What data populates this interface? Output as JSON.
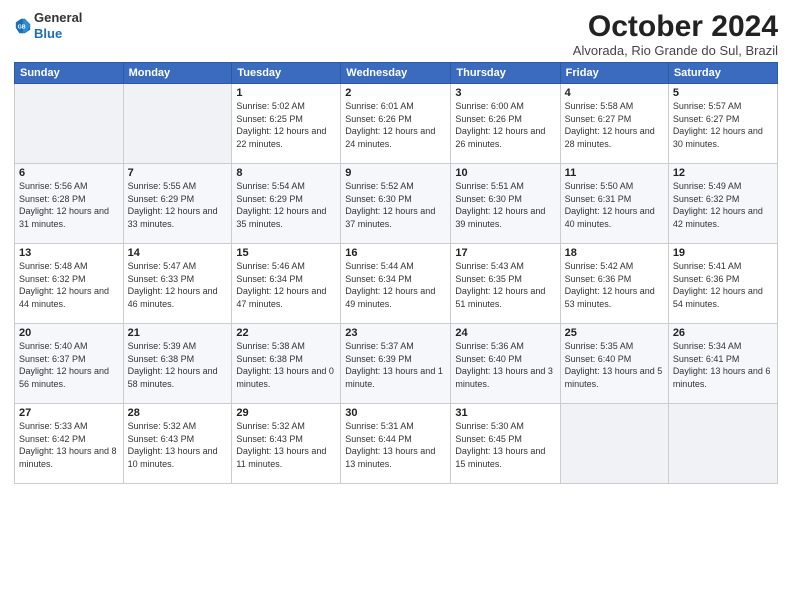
{
  "header": {
    "logo_line1": "General",
    "logo_line2": "Blue",
    "month": "October 2024",
    "location": "Alvorada, Rio Grande do Sul, Brazil"
  },
  "days_of_week": [
    "Sunday",
    "Monday",
    "Tuesday",
    "Wednesday",
    "Thursday",
    "Friday",
    "Saturday"
  ],
  "weeks": [
    [
      {
        "day": "",
        "empty": true
      },
      {
        "day": "",
        "empty": true
      },
      {
        "day": "1",
        "sunrise": "5:02 AM",
        "sunset": "6:25 PM",
        "daylight": "12 hours and 22 minutes."
      },
      {
        "day": "2",
        "sunrise": "6:01 AM",
        "sunset": "6:26 PM",
        "daylight": "12 hours and 24 minutes."
      },
      {
        "day": "3",
        "sunrise": "6:00 AM",
        "sunset": "6:26 PM",
        "daylight": "12 hours and 26 minutes."
      },
      {
        "day": "4",
        "sunrise": "5:58 AM",
        "sunset": "6:27 PM",
        "daylight": "12 hours and 28 minutes."
      },
      {
        "day": "5",
        "sunrise": "5:57 AM",
        "sunset": "6:27 PM",
        "daylight": "12 hours and 30 minutes."
      }
    ],
    [
      {
        "day": "6",
        "sunrise": "5:56 AM",
        "sunset": "6:28 PM",
        "daylight": "12 hours and 31 minutes."
      },
      {
        "day": "7",
        "sunrise": "5:55 AM",
        "sunset": "6:29 PM",
        "daylight": "12 hours and 33 minutes."
      },
      {
        "day": "8",
        "sunrise": "5:54 AM",
        "sunset": "6:29 PM",
        "daylight": "12 hours and 35 minutes."
      },
      {
        "day": "9",
        "sunrise": "5:52 AM",
        "sunset": "6:30 PM",
        "daylight": "12 hours and 37 minutes."
      },
      {
        "day": "10",
        "sunrise": "5:51 AM",
        "sunset": "6:30 PM",
        "daylight": "12 hours and 39 minutes."
      },
      {
        "day": "11",
        "sunrise": "5:50 AM",
        "sunset": "6:31 PM",
        "daylight": "12 hours and 40 minutes."
      },
      {
        "day": "12",
        "sunrise": "5:49 AM",
        "sunset": "6:32 PM",
        "daylight": "12 hours and 42 minutes."
      }
    ],
    [
      {
        "day": "13",
        "sunrise": "5:48 AM",
        "sunset": "6:32 PM",
        "daylight": "12 hours and 44 minutes."
      },
      {
        "day": "14",
        "sunrise": "5:47 AM",
        "sunset": "6:33 PM",
        "daylight": "12 hours and 46 minutes."
      },
      {
        "day": "15",
        "sunrise": "5:46 AM",
        "sunset": "6:34 PM",
        "daylight": "12 hours and 47 minutes."
      },
      {
        "day": "16",
        "sunrise": "5:44 AM",
        "sunset": "6:34 PM",
        "daylight": "12 hours and 49 minutes."
      },
      {
        "day": "17",
        "sunrise": "5:43 AM",
        "sunset": "6:35 PM",
        "daylight": "12 hours and 51 minutes."
      },
      {
        "day": "18",
        "sunrise": "5:42 AM",
        "sunset": "6:36 PM",
        "daylight": "12 hours and 53 minutes."
      },
      {
        "day": "19",
        "sunrise": "5:41 AM",
        "sunset": "6:36 PM",
        "daylight": "12 hours and 54 minutes."
      }
    ],
    [
      {
        "day": "20",
        "sunrise": "5:40 AM",
        "sunset": "6:37 PM",
        "daylight": "12 hours and 56 minutes."
      },
      {
        "day": "21",
        "sunrise": "5:39 AM",
        "sunset": "6:38 PM",
        "daylight": "12 hours and 58 minutes."
      },
      {
        "day": "22",
        "sunrise": "5:38 AM",
        "sunset": "6:38 PM",
        "daylight": "13 hours and 0 minutes."
      },
      {
        "day": "23",
        "sunrise": "5:37 AM",
        "sunset": "6:39 PM",
        "daylight": "13 hours and 1 minute."
      },
      {
        "day": "24",
        "sunrise": "5:36 AM",
        "sunset": "6:40 PM",
        "daylight": "13 hours and 3 minutes."
      },
      {
        "day": "25",
        "sunrise": "5:35 AM",
        "sunset": "6:40 PM",
        "daylight": "13 hours and 5 minutes."
      },
      {
        "day": "26",
        "sunrise": "5:34 AM",
        "sunset": "6:41 PM",
        "daylight": "13 hours and 6 minutes."
      }
    ],
    [
      {
        "day": "27",
        "sunrise": "5:33 AM",
        "sunset": "6:42 PM",
        "daylight": "13 hours and 8 minutes."
      },
      {
        "day": "28",
        "sunrise": "5:32 AM",
        "sunset": "6:43 PM",
        "daylight": "13 hours and 10 minutes."
      },
      {
        "day": "29",
        "sunrise": "5:32 AM",
        "sunset": "6:43 PM",
        "daylight": "13 hours and 11 minutes."
      },
      {
        "day": "30",
        "sunrise": "5:31 AM",
        "sunset": "6:44 PM",
        "daylight": "13 hours and 13 minutes."
      },
      {
        "day": "31",
        "sunrise": "5:30 AM",
        "sunset": "6:45 PM",
        "daylight": "13 hours and 15 minutes."
      },
      {
        "day": "",
        "empty": true
      },
      {
        "day": "",
        "empty": true
      }
    ]
  ]
}
